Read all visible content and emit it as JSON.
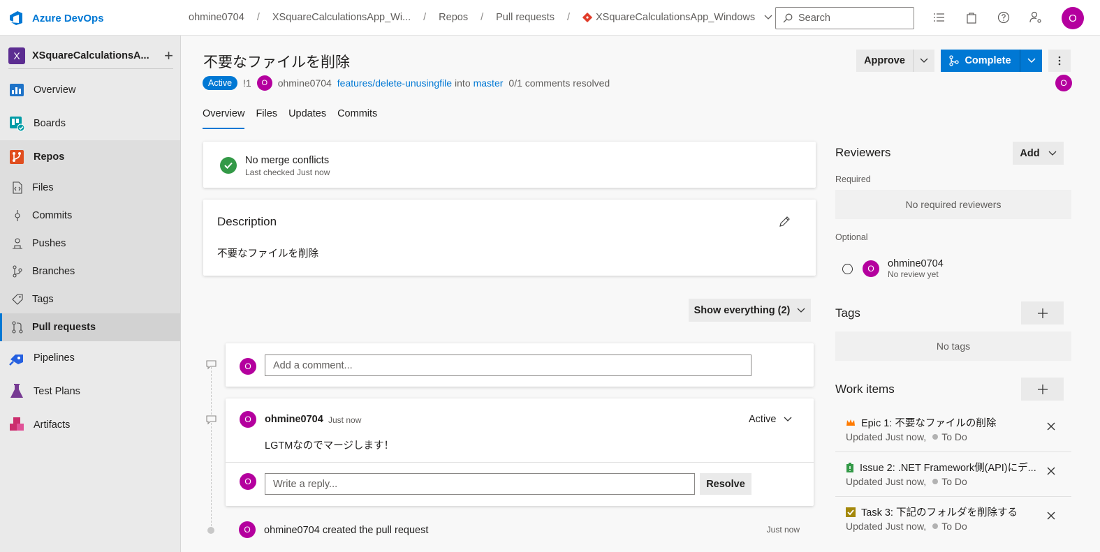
{
  "topbar": {
    "brand": "Azure DevOps",
    "breadcrumbs": [
      "ohmine0704",
      "XSquareCalculationsApp_Wi...",
      "Repos",
      "Pull requests"
    ],
    "repo_crumb": "XSquareCalculationsApp_Windows",
    "search_placeholder": "Search",
    "avatar_initial": "O"
  },
  "sidebar": {
    "project_initial": "X",
    "project_name": "XSquareCalculationsA...",
    "items": [
      {
        "label": "Overview"
      },
      {
        "label": "Boards"
      },
      {
        "label": "Repos"
      },
      {
        "label": "Files"
      },
      {
        "label": "Commits"
      },
      {
        "label": "Pushes"
      },
      {
        "label": "Branches"
      },
      {
        "label": "Tags"
      },
      {
        "label": "Pull requests"
      },
      {
        "label": "Pipelines"
      },
      {
        "label": "Test Plans"
      },
      {
        "label": "Artifacts"
      }
    ]
  },
  "pr": {
    "title": "不要なファイルを削除",
    "status": "Active",
    "id": "!1",
    "author": "ohmine0704",
    "source_branch": "features/delete-unusingfile",
    "into": "into",
    "target_branch": "master",
    "comments_resolved": "0/1 comments resolved",
    "avatar_initial": "O"
  },
  "tabs": [
    "Overview",
    "Files",
    "Updates",
    "Commits"
  ],
  "actions": {
    "approve": "Approve",
    "complete": "Complete"
  },
  "merge": {
    "title": "No merge conflicts",
    "subtitle": "Last checked Just now"
  },
  "description": {
    "heading": "Description",
    "body": "不要なファイルを削除"
  },
  "filter": {
    "label": "Show everything (2)"
  },
  "comment_box": {
    "placeholder": "Add a comment..."
  },
  "thread": {
    "author": "ohmine0704",
    "time": "Just now",
    "status": "Active",
    "body": "LGTMなのでマージします！",
    "reply_placeholder": "Write a reply...",
    "resolve": "Resolve"
  },
  "created": {
    "text": "ohmine0704 created the pull request",
    "time": "Just now"
  },
  "reviewers": {
    "heading": "Reviewers",
    "add": "Add",
    "required_label": "Required",
    "required_empty": "No required reviewers",
    "optional_label": "Optional",
    "optional": [
      {
        "initial": "O",
        "name": "ohmine0704",
        "status": "No review yet"
      }
    ]
  },
  "tags": {
    "heading": "Tags",
    "empty": "No tags"
  },
  "work_items": {
    "heading": "Work items",
    "items": [
      {
        "title": "Epic 1: 不要なファイルの削除",
        "updated": "Updated Just now,",
        "state": "To Do",
        "type_color": "#ff7b00"
      },
      {
        "title": "Issue 2: .NET Framework側(API)にデ...",
        "updated": "Updated Just now,",
        "state": "To Do",
        "type_color": "#339947"
      },
      {
        "title": "Task 3: 下記のフォルダを削除する",
        "updated": "Updated Just now,",
        "state": "To Do",
        "type_color": "#a4880a"
      }
    ]
  },
  "colors": {
    "accent": "#0078d4",
    "avatar": "#b4009e",
    "success": "#339947"
  }
}
